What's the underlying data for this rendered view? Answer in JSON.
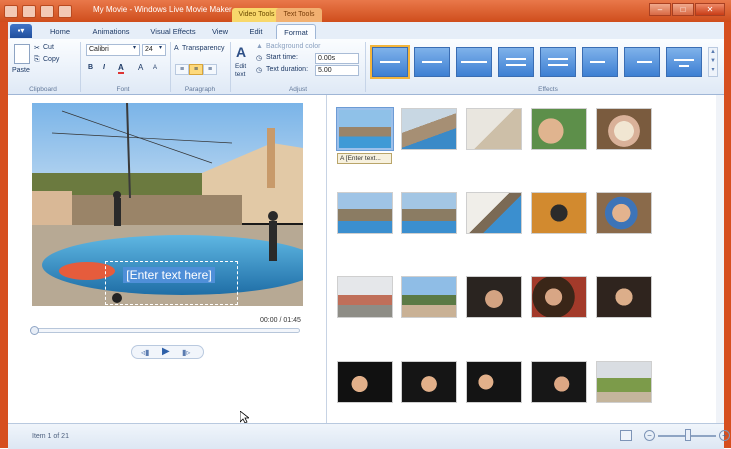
{
  "window": {
    "title": "My Movie - Windows Live Movie Maker",
    "context_tabs": [
      "Video Tools",
      "Text Tools"
    ],
    "buttons": [
      "–",
      "□",
      "✕"
    ]
  },
  "tabs": {
    "app_menu": "▪▾",
    "items": [
      "Home",
      "Animations",
      "Visual Effects",
      "View",
      "Edit",
      "Format"
    ],
    "active": "Format"
  },
  "ribbon": {
    "clipboard": {
      "paste": "Paste",
      "cut": "Cut",
      "copy": "Copy",
      "label": "Clipboard"
    },
    "font": {
      "family": "Calibri",
      "size": "24",
      "bold": "B",
      "italic": "I",
      "color": "A",
      "grow": "A",
      "shrink": "A",
      "label": "Font"
    },
    "paragraph": {
      "transparency": "Transparency",
      "label": "Paragraph"
    },
    "adjust": {
      "edit_text": "Edit\ntext",
      "background_color": "Background color",
      "start_time_label": "Start time:",
      "start_time_value": "0.00s",
      "duration_label": "Text duration:",
      "duration_value": "5.00",
      "label": "Adjust"
    },
    "effects_label": "Effects"
  },
  "preview": {
    "overlay_text": "[Enter text here]",
    "timecode": "00:00 / 01:45"
  },
  "storyboard": {
    "caption": "A [Enter text..."
  },
  "status": {
    "text": "Item 1 of 21"
  }
}
